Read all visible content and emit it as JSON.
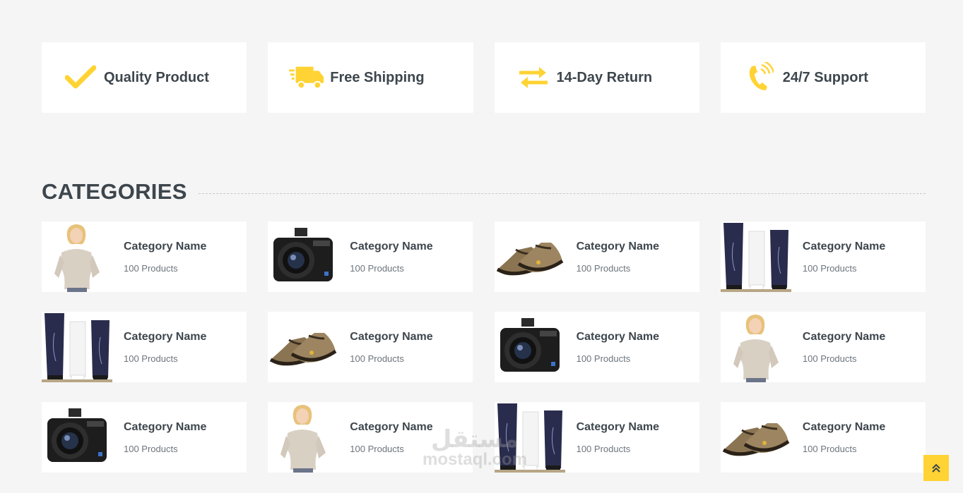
{
  "features": [
    {
      "label": "Quality Product",
      "icon": "check-icon"
    },
    {
      "label": "Free Shipping",
      "icon": "truck-icon"
    },
    {
      "label": "14-Day Return",
      "icon": "exchange-icon"
    },
    {
      "label": "24/7 Support",
      "icon": "phone-icon"
    }
  ],
  "categories_title": "CATEGORIES",
  "categories": [
    {
      "name": "Category Name",
      "count": "100 Products",
      "image": "woman"
    },
    {
      "name": "Category Name",
      "count": "100 Products",
      "image": "camera"
    },
    {
      "name": "Category Name",
      "count": "100 Products",
      "image": "shoes"
    },
    {
      "name": "Category Name",
      "count": "100 Products",
      "image": "cosmetics"
    },
    {
      "name": "Category Name",
      "count": "100 Products",
      "image": "cosmetics"
    },
    {
      "name": "Category Name",
      "count": "100 Products",
      "image": "shoes"
    },
    {
      "name": "Category Name",
      "count": "100 Products",
      "image": "camera"
    },
    {
      "name": "Category Name",
      "count": "100 Products",
      "image": "woman"
    },
    {
      "name": "Category Name",
      "count": "100 Products",
      "image": "camera"
    },
    {
      "name": "Category Name",
      "count": "100 Products",
      "image": "woman"
    },
    {
      "name": "Category Name",
      "count": "100 Products",
      "image": "cosmetics"
    },
    {
      "name": "Category Name",
      "count": "100 Products",
      "image": "shoes"
    }
  ],
  "watermark": {
    "arabic": "مستقل",
    "latin": "mostaql.com"
  },
  "colors": {
    "accent": "#ffd333",
    "text": "#3d464d",
    "background": "#f5f5f5",
    "card": "#ffffff"
  }
}
